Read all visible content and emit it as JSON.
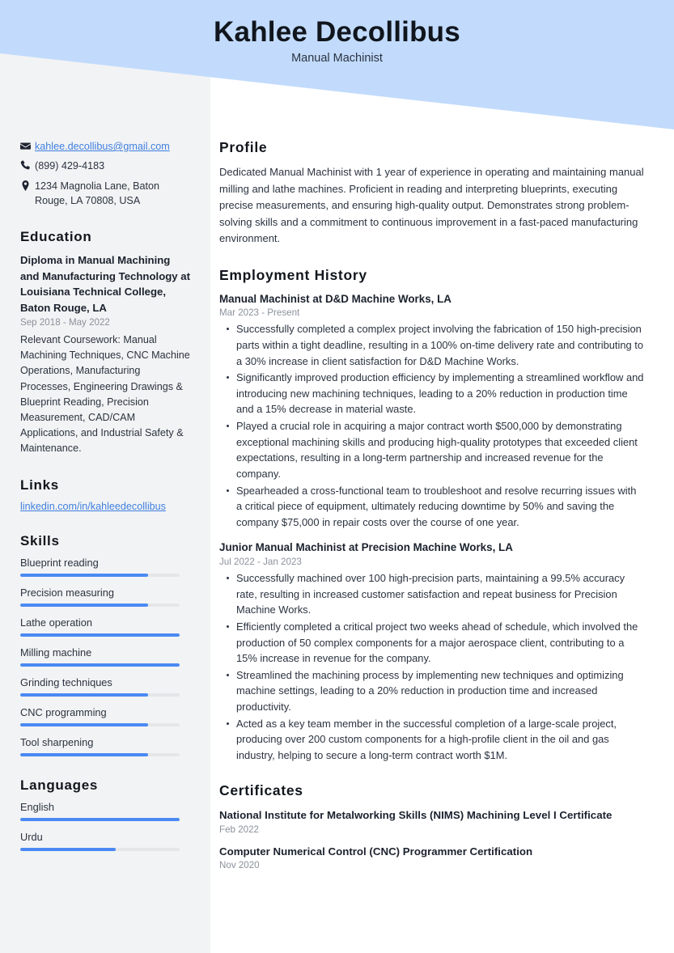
{
  "header": {
    "name": "Kahlee Decollibus",
    "job_title": "Manual Machinist",
    "banner_color": "#c2dbfc"
  },
  "theme": {
    "accent": "#4a89f3",
    "sidebar_bg": "#f2f3f4",
    "link_color": "#3f7fe0",
    "text": "#2b3340",
    "muted": "#8b919b"
  },
  "contact": {
    "email": "kahlee.decollibus@gmail.com",
    "phone": "(899) 429-4183",
    "address": "1234 Magnolia Lane, Baton Rouge, LA 70808, USA",
    "icons": {
      "email": "envelope-icon",
      "phone": "phone-icon",
      "address": "location-pin-icon"
    }
  },
  "education": {
    "heading": "Education",
    "entries": [
      {
        "title": "Diploma in Manual Machining and Manufacturing Technology at Louisiana Technical College, Baton Rouge, LA",
        "date": "Sep 2018 - May 2022",
        "description": "Relevant Coursework: Manual Machining Techniques, CNC Machine Operations, Manufacturing Processes, Engineering Drawings & Blueprint Reading, Precision Measurement, CAD/CAM Applications, and Industrial Safety & Maintenance."
      }
    ]
  },
  "links": {
    "heading": "Links",
    "items": [
      {
        "label": "linkedin.com/in/kahleedecollibus"
      }
    ]
  },
  "skills": {
    "heading": "Skills",
    "items": [
      {
        "label": "Blueprint reading",
        "level": 80
      },
      {
        "label": "Precision measuring",
        "level": 80
      },
      {
        "label": "Lathe operation",
        "level": 100
      },
      {
        "label": "Milling machine",
        "level": 100
      },
      {
        "label": "Grinding techniques",
        "level": 80
      },
      {
        "label": "CNC programming",
        "level": 80
      },
      {
        "label": "Tool sharpening",
        "level": 80
      }
    ]
  },
  "languages": {
    "heading": "Languages",
    "items": [
      {
        "label": "English",
        "level": 100
      },
      {
        "label": "Urdu",
        "level": 60
      }
    ]
  },
  "profile": {
    "heading": "Profile",
    "text": "Dedicated Manual Machinist with 1 year of experience in operating and maintaining manual milling and lathe machines. Proficient in reading and interpreting blueprints, executing precise measurements, and ensuring high-quality output. Demonstrates strong problem-solving skills and a commitment to continuous improvement in a fast-paced manufacturing environment."
  },
  "employment": {
    "heading": "Employment History",
    "jobs": [
      {
        "title": "Manual Machinist at D&D Machine Works, LA",
        "date": "Mar 2023 - Present",
        "bullets": [
          "Successfully completed a complex project involving the fabrication of 150 high-precision parts within a tight deadline, resulting in a 100% on-time delivery rate and contributing to a 30% increase in client satisfaction for D&D Machine Works.",
          "Significantly improved production efficiency by implementing a streamlined workflow and introducing new machining techniques, leading to a 20% reduction in production time and a 15% decrease in material waste.",
          "Played a crucial role in acquiring a major contract worth $500,000 by demonstrating exceptional machining skills and producing high-quality prototypes that exceeded client expectations, resulting in a long-term partnership and increased revenue for the company.",
          "Spearheaded a cross-functional team to troubleshoot and resolve recurring issues with a critical piece of equipment, ultimately reducing downtime by 50% and saving the company $75,000 in repair costs over the course of one year."
        ]
      },
      {
        "title": "Junior Manual Machinist at Precision Machine Works, LA",
        "date": "Jul 2022 - Jan 2023",
        "bullets": [
          "Successfully machined over 100 high-precision parts, maintaining a 99.5% accuracy rate, resulting in increased customer satisfaction and repeat business for Precision Machine Works.",
          "Efficiently completed a critical project two weeks ahead of schedule, which involved the production of 50 complex components for a major aerospace client, contributing to a 15% increase in revenue for the company.",
          "Streamlined the machining process by implementing new techniques and optimizing machine settings, leading to a 20% reduction in production time and increased productivity.",
          "Acted as a key team member in the successful completion of a large-scale project, producing over 200 custom components for a high-profile client in the oil and gas industry, helping to secure a long-term contract worth $1M."
        ]
      }
    ]
  },
  "certificates": {
    "heading": "Certificates",
    "items": [
      {
        "name": "National Institute for Metalworking Skills (NIMS) Machining Level I Certificate",
        "date": "Feb 2022"
      },
      {
        "name": "Computer Numerical Control (CNC) Programmer Certification",
        "date": "Nov 2020"
      }
    ]
  }
}
